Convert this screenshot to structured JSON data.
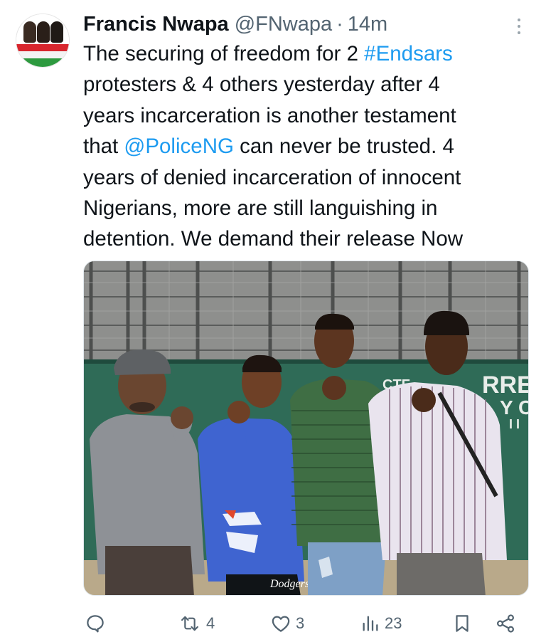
{
  "tweet": {
    "author_name": "Francis Nwapa",
    "handle": "@FNwapa",
    "separator": "·",
    "time": "14m",
    "text_lines": [
      [
        "The securing of freedom for 2 ",
        "#Endsars"
      ],
      [
        "protesters & 4 others yesterday after 4"
      ],
      [
        "years incarceration is another testament"
      ],
      [
        "that ",
        "@PoliceNG",
        " can never be trusted. 4"
      ],
      [
        "years of denied incarceration of innocent"
      ],
      [
        "Nigerians, more are still languishing in"
      ],
      [
        "detention. We demand their release Now"
      ]
    ],
    "hashtag": "#Endsars",
    "mention": "@PoliceNG"
  },
  "photo": {
    "van_text_1": "CTF",
    "van_text_2": "RRECT",
    "van_text_3": "Y C",
    "van_text_4": "I I",
    "shirt_text": "Dodgers"
  },
  "actions": {
    "reply_count": "",
    "retweet_count": "4",
    "like_count": "3",
    "views_count": "23"
  },
  "colors": {
    "link": "#1d9bf0",
    "text": "#0f1419",
    "secondary": "#536471",
    "van_green": "#2f6b57"
  }
}
